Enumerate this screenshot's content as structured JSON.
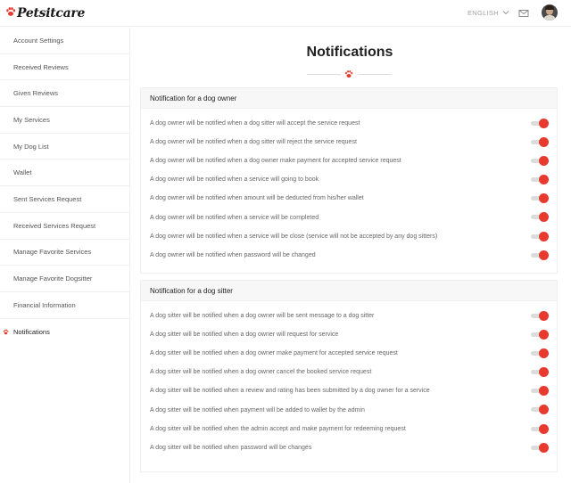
{
  "brand": {
    "name": "Petsitcare",
    "accent": "#e8392f"
  },
  "header": {
    "language": "ENGLISH"
  },
  "sidebar": {
    "items": [
      {
        "label": "Account Settings"
      },
      {
        "label": "Received Reviews"
      },
      {
        "label": "Given Reviews"
      },
      {
        "label": "My Services"
      },
      {
        "label": "My Dog List"
      },
      {
        "label": "Wallet"
      },
      {
        "label": "Sent Services Request"
      },
      {
        "label": "Received Services Request"
      },
      {
        "label": "Manage Favorite Services"
      },
      {
        "label": "Manage Favorite Dogsitter"
      },
      {
        "label": "Financial Information"
      },
      {
        "label": "Notifications",
        "active": true
      }
    ]
  },
  "page": {
    "title": "Notifications"
  },
  "owner_section": {
    "heading": "Notification for a dog owner",
    "rows": [
      {
        "text": "A dog owner will be notified when a dog sitter will accept the service request",
        "enabled": true
      },
      {
        "text": "A dog owner will be notified when a dog sitter will reject the service request",
        "enabled": true
      },
      {
        "text": "A dog owner will be notified when a dog owner make payment for accepted service request",
        "enabled": true
      },
      {
        "text": "A dog owner will be notified when a service will going to book",
        "enabled": true
      },
      {
        "text": "A dog owner will be notified when amount will be deducted from his/her wallet",
        "enabled": true
      },
      {
        "text": "A dog owner will be notified when a service will be completed",
        "enabled": true
      },
      {
        "text": "A dog owner will be notified when a service will be close (service will not be accepted by any dog sitters)",
        "enabled": true
      },
      {
        "text": "A dog owner will be notified when password will be changed",
        "enabled": true
      }
    ]
  },
  "sitter_section": {
    "heading": "Notification for a dog sitter",
    "rows": [
      {
        "text": "A dog sitter will be notified when a dog owner will be sent message to a dog sitter",
        "enabled": true
      },
      {
        "text": "A dog sitter will be notified when a dog owner will request for service",
        "enabled": true
      },
      {
        "text": "A dog sitter will be notified when a dog owner make payment for accepted service request",
        "enabled": true
      },
      {
        "text": "A dog sitter will be notified when a dog owner cancel the booked service request",
        "enabled": true
      },
      {
        "text": "A dog sitter will be notified when a review and rating has been submitted by a dog owner for a service",
        "enabled": true
      },
      {
        "text": "A dog sitter will be notified when payment will be added to wallet by the admin",
        "enabled": true
      },
      {
        "text": "A dog sitter will be notified when the admin accept and make payment for redeeming request",
        "enabled": true
      },
      {
        "text": "A dog sitter will be notified when password will be changes",
        "enabled": true
      }
    ]
  }
}
